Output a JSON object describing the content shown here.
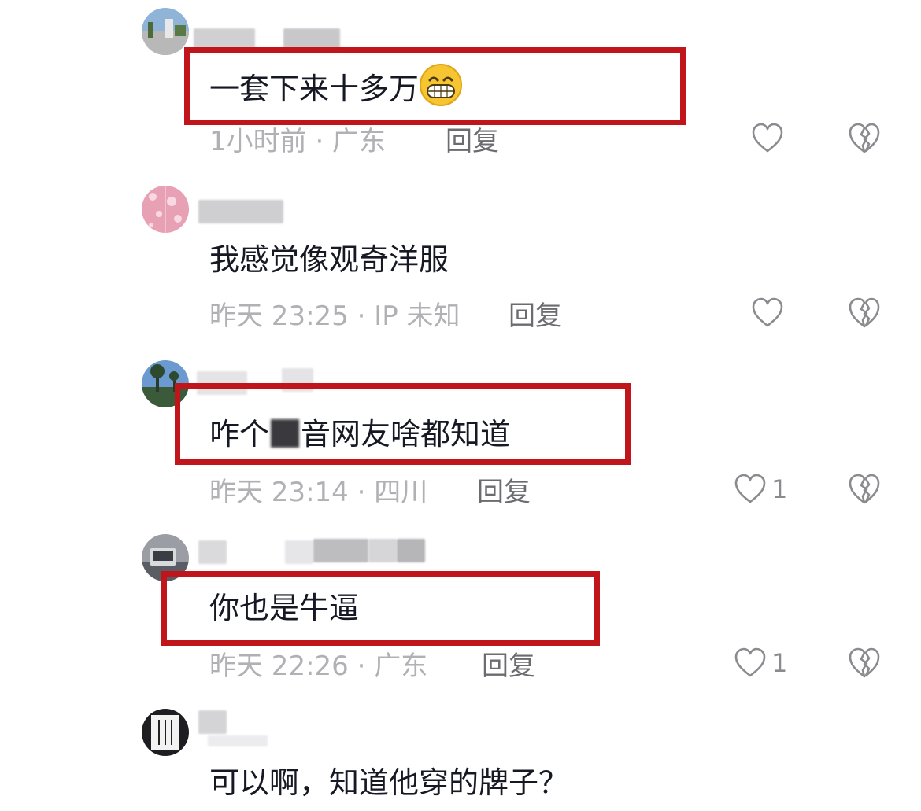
{
  "comments": [
    {
      "text": "一套下来十多万",
      "meta": "1小时前 · 广东",
      "reply": "回复",
      "likes": "",
      "highlighted": true
    },
    {
      "text": "我感觉像观奇洋服",
      "meta": "昨天 23:25 · IP 未知",
      "reply": "回复",
      "likes": "",
      "highlighted": false
    },
    {
      "text_before": "咋个",
      "text_after": "音网友啥都知道",
      "meta": "昨天 23:14 · 四川",
      "reply": "回复",
      "likes": "1",
      "highlighted": true
    },
    {
      "text": "你也是牛逼",
      "meta": "昨天 22:26 · 广东",
      "reply": "回复",
      "likes": "1",
      "highlighted": true
    },
    {
      "text": "可以啊，知道他穿的牌子？",
      "highlighted": false
    }
  ],
  "colors": {
    "highlight": "#c0161b",
    "meta": "#b0b0b5",
    "reply": "#6b6b70",
    "icon": "#8a8a8f"
  },
  "icons": {
    "like": "heart-outline-icon",
    "dislike": "broken-heart-icon",
    "emoji": "grinning-face-emoji"
  }
}
